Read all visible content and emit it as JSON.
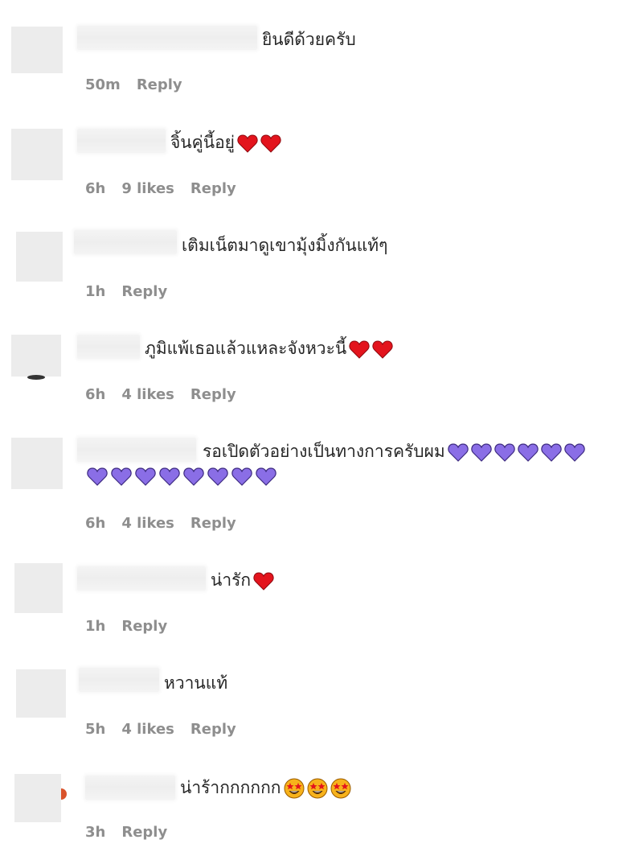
{
  "emoji": {
    "red_heart_color": "#e3141d",
    "purple_heart_color": "#8a6ee6",
    "star_struck_color": "#f7b21b"
  },
  "comments": [
    {
      "text": "ยินดีด้วยครับ",
      "time": "50m",
      "likes": "",
      "reply": "Reply",
      "emojis": []
    },
    {
      "text": "จิ้นคู่นี้อยู่",
      "time": "6h",
      "likes": "9 likes",
      "reply": "Reply",
      "emojis": [
        "red-heart",
        "red-heart"
      ]
    },
    {
      "text": "เติมเน็ตมาดูเขามุ้งมิ้งกันแท้ๆ",
      "time": "1h",
      "likes": "",
      "reply": "Reply",
      "emojis": []
    },
    {
      "text": "ภูมิแพ้เธอแล้วแหละจังหวะนี้",
      "time": "6h",
      "likes": "4 likes",
      "reply": "Reply",
      "emojis": [
        "red-heart",
        "red-heart"
      ]
    },
    {
      "text": "รอเปิดตัวอย่างเป็นทางการครับผม",
      "time": "6h",
      "likes": "4 likes",
      "reply": "Reply",
      "emojis": [
        "purple-heart",
        "purple-heart",
        "purple-heart",
        "purple-heart",
        "purple-heart",
        "purple-heart",
        "purple-heart",
        "purple-heart",
        "purple-heart",
        "purple-heart",
        "purple-heart",
        "purple-heart",
        "purple-heart",
        "purple-heart"
      ]
    },
    {
      "text": "น่ารัก",
      "time": "1h",
      "likes": "",
      "reply": "Reply",
      "emojis": [
        "red-heart"
      ]
    },
    {
      "text": "หวานแท้",
      "time": "5h",
      "likes": "4 likes",
      "reply": "Reply",
      "emojis": []
    },
    {
      "text": "น่าร้ากกกกกก",
      "time": "3h",
      "likes": "",
      "reply": "Reply",
      "emojis": [
        "star-struck",
        "star-struck",
        "star-struck"
      ]
    }
  ]
}
